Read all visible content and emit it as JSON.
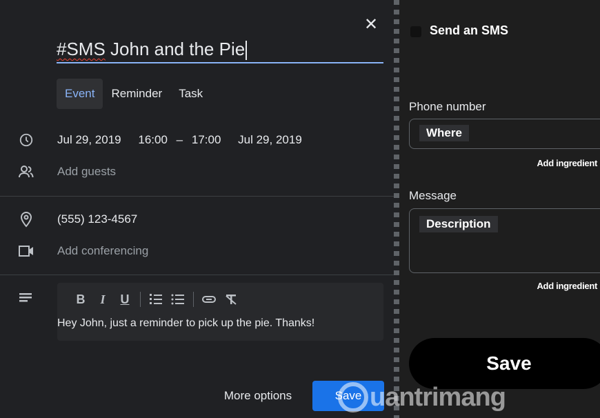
{
  "event": {
    "title_prefix": "#SMS",
    "title_rest": " John and the Pie",
    "tabs": [
      {
        "label": "Event",
        "active": true
      },
      {
        "label": "Reminder",
        "active": false
      },
      {
        "label": "Task",
        "active": false
      }
    ],
    "start_date": "Jul 29, 2019",
    "start_time": "16:00",
    "dash": "–",
    "end_time": "17:00",
    "end_date": "Jul 29, 2019",
    "guests_placeholder": "Add guests",
    "location": "(555) 123-4567",
    "conferencing": "Add conferencing",
    "description": "Hey John, just a reminder to pick up the pie. Thanks!",
    "more_options": "More options",
    "save": "Save"
  },
  "sms": {
    "title": "Send an SMS",
    "phone_label": "Phone number",
    "phone_value": "Where",
    "add_ingredient": "Add ingredient",
    "message_label": "Message",
    "message_value": "Description",
    "save": "Save"
  },
  "watermark": {
    "text": "uantrimang"
  },
  "colors": {
    "accent": "#8ab4f8",
    "primary_button": "#1a73e8",
    "background": "#202124"
  }
}
